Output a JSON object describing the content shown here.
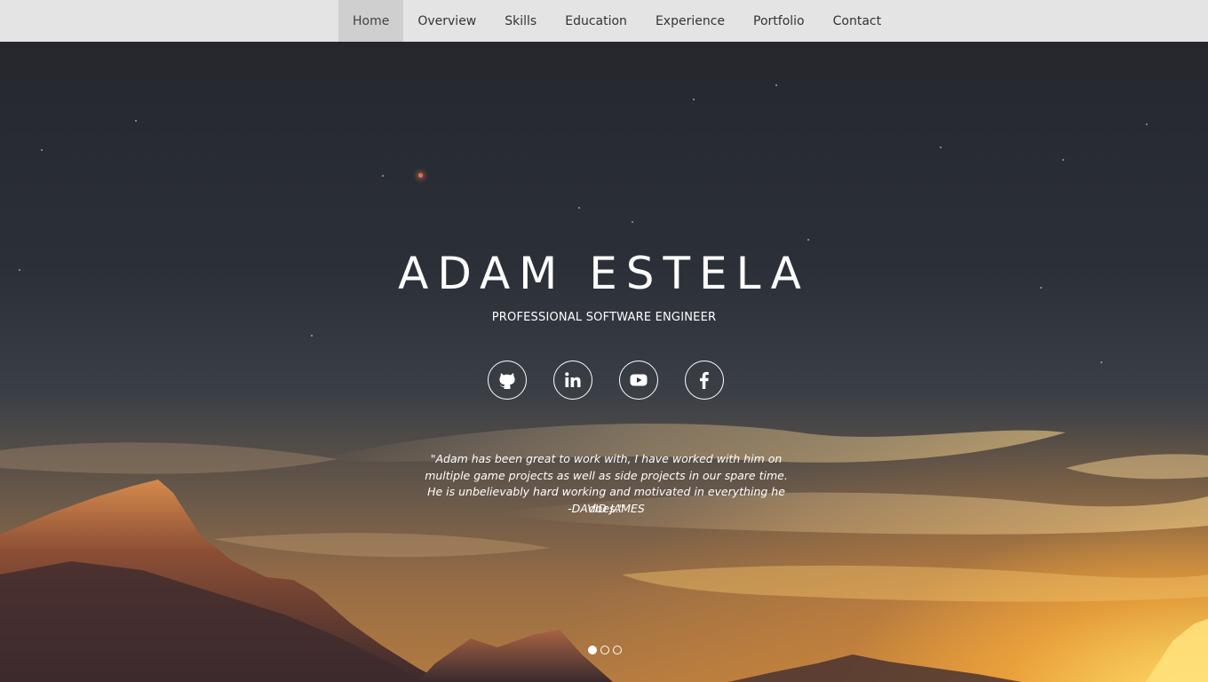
{
  "nav": {
    "items": [
      {
        "label": "Home",
        "active": true
      },
      {
        "label": "Overview"
      },
      {
        "label": "Skills"
      },
      {
        "label": "Education"
      },
      {
        "label": "Experience"
      },
      {
        "label": "Portfolio"
      },
      {
        "label": "Contact"
      }
    ]
  },
  "hero": {
    "name": "ADAM ESTELA",
    "role": "PROFESSIONAL SOFTWARE ENGINEER",
    "socials": [
      {
        "icon": "github-icon"
      },
      {
        "icon": "linkedin-icon"
      },
      {
        "icon": "youtube-icon"
      },
      {
        "icon": "facebook-icon"
      }
    ],
    "testimonial": {
      "quote": "\"Adam has been great to work with, I have worked with him on multiple game projects as well as side projects in our spare time. He is unbelievably hard working and motivated in everything he does.\"",
      "author": "-DAVID JAMES"
    },
    "carousel": {
      "slides": 3,
      "active": 1
    }
  },
  "colors": {
    "nav_bg": "#e4e4e4",
    "nav_active_bg": "#cfcfcf",
    "sky_top": "#25272d",
    "sunset": "#ffd45a"
  }
}
